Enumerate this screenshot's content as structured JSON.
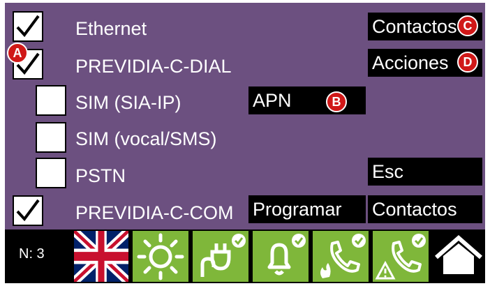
{
  "rows": [
    {
      "label": "Ethernet",
      "checked": true
    },
    {
      "label": "PREVIDIA-C-DIAL",
      "checked": true
    },
    {
      "label": "SIM (SIA-IP)",
      "checked": false
    },
    {
      "label": "SIM (vocal/SMS)",
      "checked": false
    },
    {
      "label": "PSTN",
      "checked": false
    },
    {
      "label": "PREVIDIA-C-COM",
      "checked": true
    }
  ],
  "buttons": {
    "contactos_top": "Contactos",
    "acciones": "Acciones",
    "apn": "APN",
    "esc": "Esc",
    "programar": "Programar",
    "contactos_bottom": "Contactos"
  },
  "markers": {
    "a": "A",
    "b": "B",
    "c": "C",
    "d": "D"
  },
  "status_bar": {
    "node": "N: 3",
    "icons": [
      "uk-flag-icon",
      "sun-icon",
      "power-plug-icon",
      "bell-icon",
      "fire-phone-icon",
      "fault-phone-icon",
      "home-icon"
    ]
  },
  "colors": {
    "background": "#6c5080",
    "tile_green": "#7fb73a",
    "marker_red": "#d01818"
  }
}
